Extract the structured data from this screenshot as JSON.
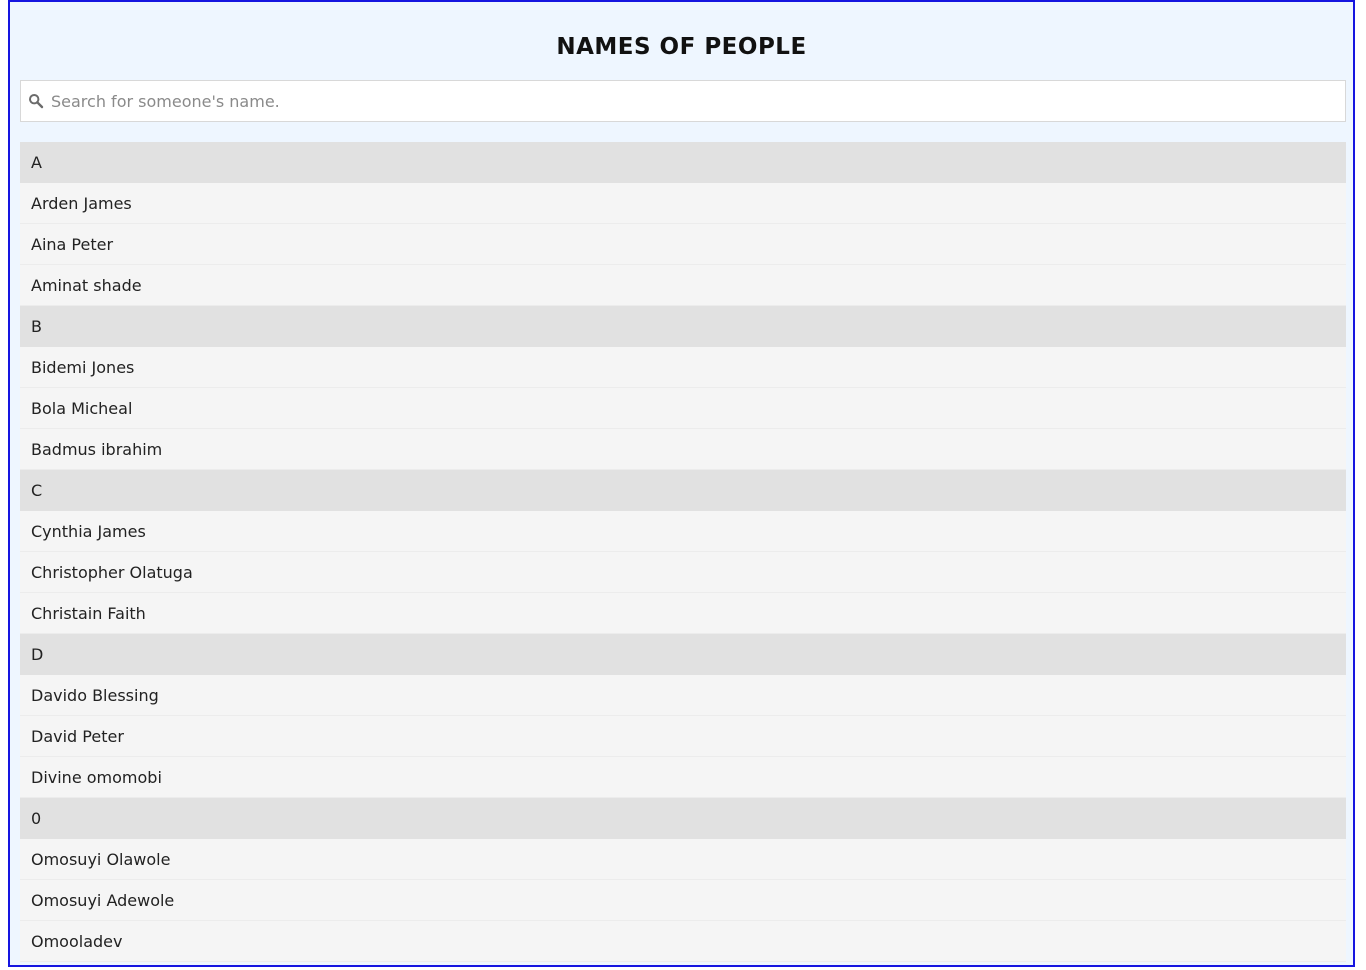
{
  "title": "NAMES OF PEOPLE",
  "search": {
    "placeholder": "Search for someone's name.",
    "value": "",
    "icon": "search-icon"
  },
  "groups": [
    {
      "letter": "A",
      "names": [
        "Arden James",
        "Aina Peter",
        "Aminat shade"
      ]
    },
    {
      "letter": "B",
      "names": [
        "Bidemi Jones",
        "Bola Micheal",
        "Badmus ibrahim"
      ]
    },
    {
      "letter": "C",
      "names": [
        "Cynthia James",
        "Christopher Olatuga",
        "Christain Faith"
      ]
    },
    {
      "letter": "D",
      "names": [
        "Davido Blessing",
        "David Peter",
        "Divine omomobi"
      ]
    },
    {
      "letter": "0",
      "names": [
        "Omosuyi Olawole",
        "Omosuyi Adewole",
        "Omooladev"
      ]
    }
  ],
  "colors": {
    "border": "#1515e0",
    "background": "#eef6ff",
    "header_row": "#e1e1e1",
    "item_row": "#f5f5f5"
  }
}
